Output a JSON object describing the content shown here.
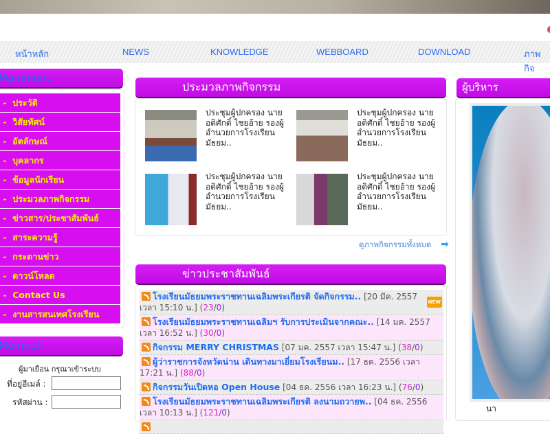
{
  "nav": [
    "หน้าหลัก",
    "NEWS",
    "KNOWLEDGE",
    "WEBBOARD",
    "DOWNLOAD",
    "ภาพกิจ"
  ],
  "mainmenu": {
    "title": "Mainmenu",
    "items": [
      "ประวัติ",
      "วิสัยทัศน์",
      "อัตลักษณ์",
      "บุคลากร",
      "ข้อมูลนักเรียน",
      "ประมวลภาพกิจกรรม",
      "ข่าวสาร/ประชาสัมพันธ์",
      "สาระความรู้",
      "กระดานข่าว",
      "ดาวน์โหลด",
      "Contact Us",
      "งานสารสนเทศโรงเรียน"
    ]
  },
  "member": {
    "title": "Member",
    "greeting": "ผู้มาเยือน กรุณาเข้าระบบ",
    "email_label": "ที่อยู่อีเมล์ :",
    "password_label": "รหัสผ่าน :",
    "email_value": "",
    "password_value": ""
  },
  "gallery": {
    "title": "ประมวลภาพกิจกรรม",
    "items": [
      {
        "caption": "ประชุมผู้ปกครอง นายอดิศักดิ์ ไชยอ้าย รองผู้อำนวยการโรงเรียนมัธยม.."
      },
      {
        "caption": "ประชุมผู้ปกครอง นายอดิศักดิ์ ไชยอ้าย รองผู้อำนวยการโรงเรียนมัธยม.."
      },
      {
        "caption": "ประชุมผู้ปกครอง นายอดิศักดิ์ ไชยอ้าย รองผู้อำนวยการโรงเรียนมัธยม.."
      },
      {
        "caption": "ประชุมผู้ปกครอง นายอดิศักดิ์ ไชยอ้าย รองผู้อำนวยการโรงเรียนมัธยม.."
      }
    ],
    "view_all": "ดูภาพกิจกรรมทั้งหมด"
  },
  "news": {
    "title": "ข่าวประชาสัมพันธ์",
    "new_badge": "NEW",
    "items": [
      {
        "title": "โรงเรียนมัธยมพระราชทานเฉลิมพระเกียรติ จัดกิจกรรม..",
        "date": "[20 มีค. 2557 เวลา 15:10 น.]",
        "views": "23",
        "replies": "0"
      },
      {
        "title": "โรงเรียนมัธยมพระราชทานเฉลิมฯ รับการประเมินจากคณะ..",
        "date": "[14 มค. 2557 เวลา 16:52 น.]",
        "views": "30",
        "replies": "0"
      },
      {
        "title": "กิจกรรม MERRY CHRISTMAS",
        "date": "[07 มค. 2557 เวลา 15:47 น.]",
        "views": "38",
        "replies": "0"
      },
      {
        "title": "ผู้ว่าราชการจังหวัดน่าน เดินทางมาเยี่ยมโรงเรียนม..",
        "date": "[17 ธค. 2556 เวลา 17:21 น.]",
        "views": "88",
        "replies": "0"
      },
      {
        "title": "กิจกรรมวันเปิดหอ Open House",
        "date": "[04 ธค. 2556 เวลา 16:23 น.]",
        "views": "76",
        "replies": "0"
      },
      {
        "title": "โรงเรียนมัธยมพระราชทานเฉลิมพระเกียรติ ลงนามถวายพ..",
        "date": "[04 ธค. 2556 เวลา 10:13 น.]",
        "views": "121",
        "replies": "0"
      }
    ]
  },
  "admin": {
    "title": "ผู้บริหาร",
    "caption": "นา"
  }
}
